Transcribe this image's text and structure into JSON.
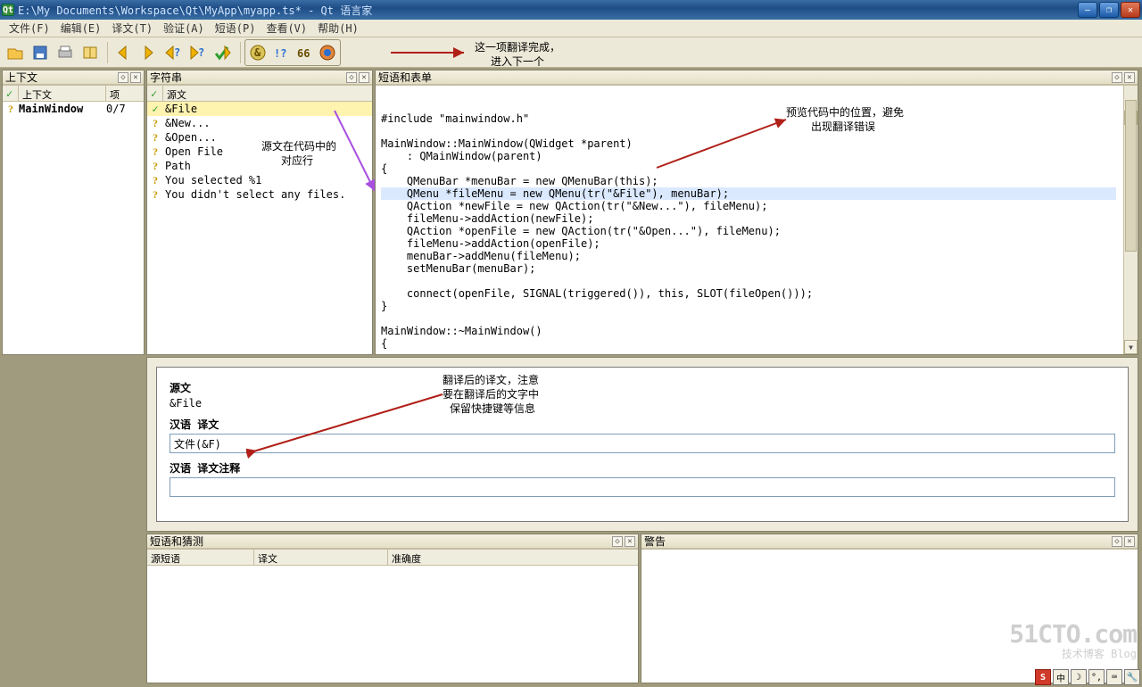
{
  "titlebar": {
    "path": "E:\\My Documents\\Workspace\\Qt\\MyApp\\myapp.ts* - Qt 语言家"
  },
  "menu": [
    "文件(F)",
    "编辑(E)",
    "译文(T)",
    "验证(A)",
    "短语(P)",
    "查看(V)",
    "帮助(H)"
  ],
  "annot": {
    "toolbar1": "这一项翻译完成，",
    "toolbar2": "进入下一个",
    "strings1": "源文在代码中的",
    "strings2": "对应行",
    "source1": "预览代码中的位置，避免",
    "source2": "出现翻译错误",
    "form1": "翻译后的译文，注意",
    "form2": "要在翻译后的文字中",
    "form3": "保留快捷键等信息"
  },
  "docks": {
    "context_title": "上下文",
    "context_cols": {
      "c1": "上下文",
      "c2": "项"
    },
    "strings_title": "字符串",
    "strings_col": "源文",
    "source_title": "短语和表单",
    "phrases_title": "短语和猜测",
    "phrases_cols": {
      "c0": "源短语",
      "c1": "译文",
      "c2": "准确度"
    },
    "warnings_title": "警告"
  },
  "context_rows": [
    {
      "name": "MainWindow",
      "count": "0/7"
    }
  ],
  "string_rows": [
    {
      "txt": "&File",
      "sel": true,
      "done": true
    },
    {
      "txt": "&New...",
      "sel": false,
      "done": false
    },
    {
      "txt": "&Open...",
      "sel": false,
      "done": false
    },
    {
      "txt": "Open File",
      "sel": false,
      "done": false
    },
    {
      "txt": "Path",
      "sel": false,
      "done": false
    },
    {
      "txt": "You selected %1",
      "sel": false,
      "done": false
    },
    {
      "txt": "You didn't select any files.",
      "sel": false,
      "done": false
    }
  ],
  "source_lines": [
    {
      "t": "#include \"mainwindow.h\""
    },
    {
      "t": ""
    },
    {
      "t": "MainWindow::MainWindow(QWidget *parent)"
    },
    {
      "t": "    : QMainWindow(parent)"
    },
    {
      "t": "{"
    },
    {
      "t": "    QMenuBar *menuBar = new QMenuBar(this);"
    },
    {
      "t": "    QMenu *fileMenu = new QMenu(tr(\"&File\"), menuBar);",
      "hl": true
    },
    {
      "t": "    QAction *newFile = new QAction(tr(\"&New...\"), fileMenu);"
    },
    {
      "t": "    fileMenu->addAction(newFile);"
    },
    {
      "t": "    QAction *openFile = new QAction(tr(\"&Open...\"), fileMenu);"
    },
    {
      "t": "    fileMenu->addAction(openFile);"
    },
    {
      "t": "    menuBar->addMenu(fileMenu);"
    },
    {
      "t": "    setMenuBar(menuBar);"
    },
    {
      "t": ""
    },
    {
      "t": "    connect(openFile, SIGNAL(triggered()), this, SLOT(fileOpen()));"
    },
    {
      "t": "}"
    },
    {
      "t": ""
    },
    {
      "t": "MainWindow::~MainWindow()"
    },
    {
      "t": "{"
    },
    {
      "t": ""
    },
    {
      "t": "}"
    }
  ],
  "form": {
    "src_label": "源文",
    "src_value": "&File",
    "trans_label": "汉语 译文",
    "trans_value": "文件(&F)",
    "comment_label": "汉语 译文注释",
    "comment_value": ""
  },
  "watermark": {
    "big": "51CTO.com",
    "small": "技术博客   Blog"
  },
  "tray": {
    "red": "S",
    "cn": "中"
  }
}
